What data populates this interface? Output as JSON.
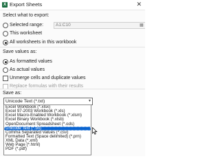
{
  "window": {
    "title": "Export Sheets",
    "close_glyph": "✕",
    "app_icon_letter": "X"
  },
  "what_to_export": {
    "heading": "Select what to export:",
    "options": [
      {
        "label": "Selected range:",
        "checked": false
      },
      {
        "label": "This worksheet",
        "checked": false
      },
      {
        "label": "All worksheets in this workbook",
        "checked": true
      }
    ],
    "range_value": "A1:C10"
  },
  "save_values": {
    "heading": "Save values as:",
    "options": [
      {
        "label": "As formatted values",
        "checked": true
      },
      {
        "label": "As actual values",
        "checked": false
      }
    ],
    "checkboxes": [
      {
        "label": "Unmerge cells and duplicate values",
        "checked": false,
        "enabled": true
      },
      {
        "label": "Replace formulas with their results",
        "checked": false,
        "enabled": false
      }
    ]
  },
  "save_as": {
    "heading": "Save as:",
    "selected_value": "Unicode Text (*.txt)",
    "items": [
      "Excel Workbook (*.xlsx)",
      "Excel 97-2003 Workbook (*.xls)",
      "Excel Macro-Enabled Workbook (*.xlsm)",
      "Excel Binary Workbook (*.xlsb)",
      "OpenDocument Spreadsheet (*.ods)",
      "Unicode Text (*.txt)",
      "Comma Separated Values (*.csv)",
      "Formatted Text (Space delimited) (*.prn)",
      "XML Data (*.xml)",
      "Web Page (*.html)",
      "PDF (*.pdf)"
    ],
    "selected_index": 5
  },
  "icons": {
    "close": "close-icon",
    "dropdown": "chevron-down-icon",
    "range_picker": "range-picker-icon",
    "cursor": "mouse-cursor-icon",
    "app": "excel-app-icon"
  },
  "colors": {
    "selection": "#0a64d0",
    "app_icon": "#1d6f42"
  }
}
